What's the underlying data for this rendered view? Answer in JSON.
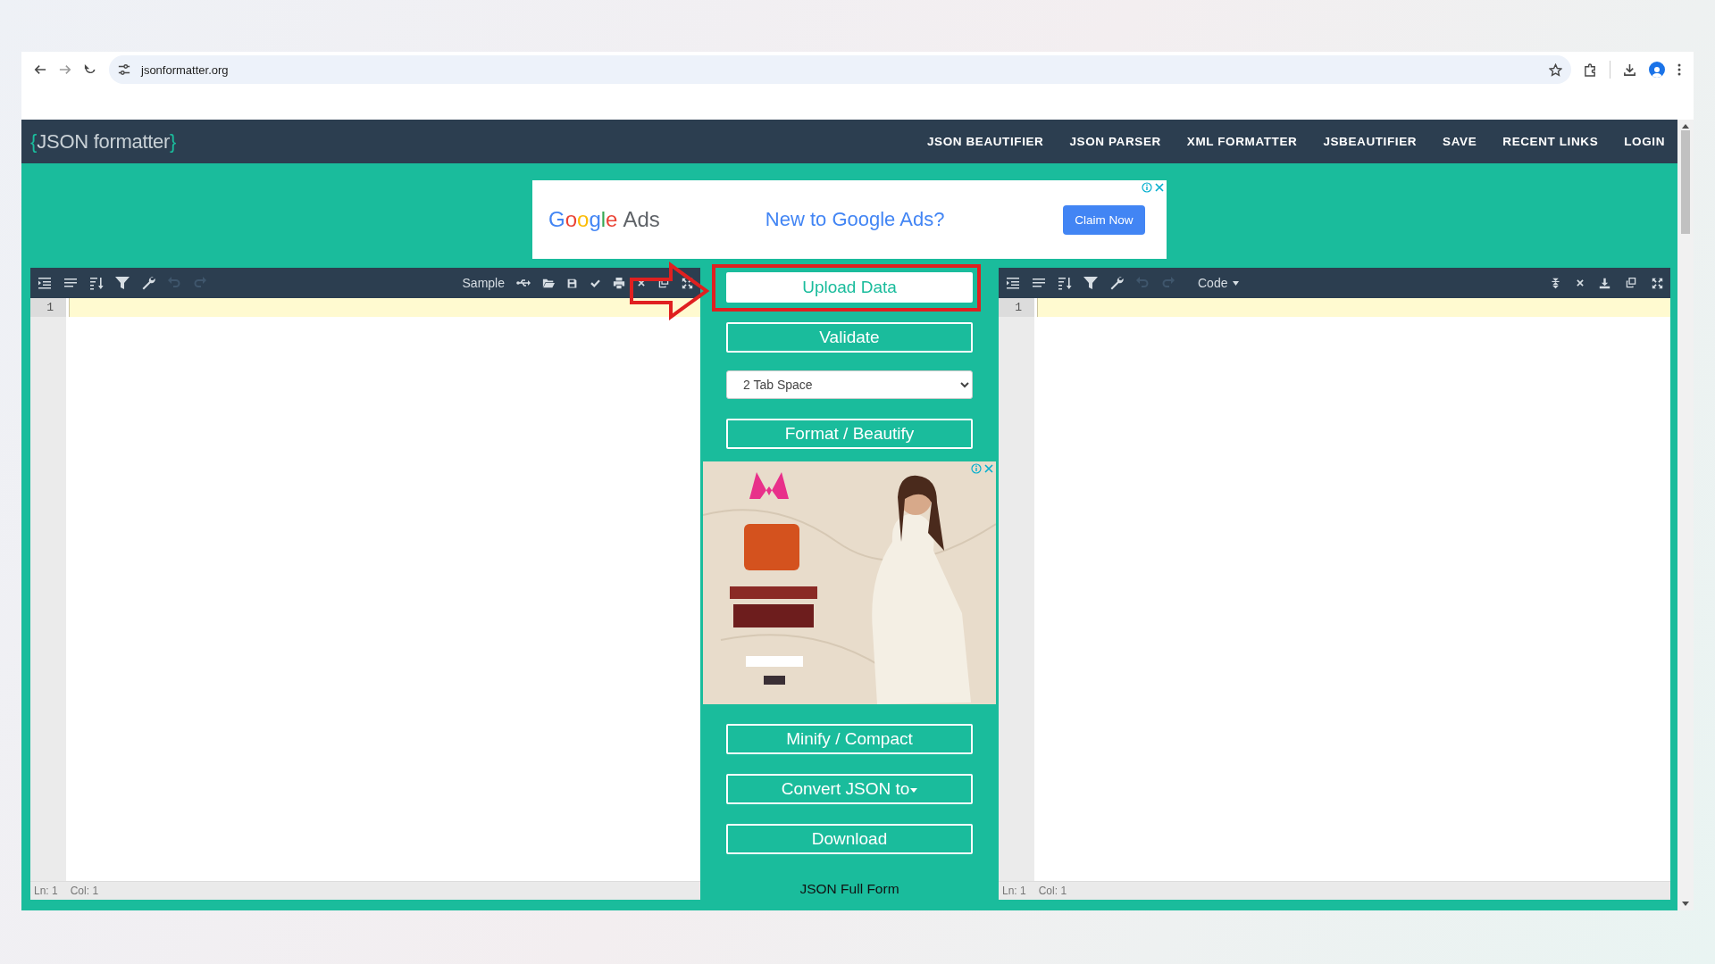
{
  "browser": {
    "url": "jsonformatter.org"
  },
  "site": {
    "logo": {
      "open": "{",
      "name": "JSON formatter",
      "close": "}"
    },
    "nav": [
      "JSON BEAUTIFIER",
      "JSON PARSER",
      "XML FORMATTER",
      "JSBEAUTIFIER",
      "SAVE",
      "RECENT LINKS",
      "LOGIN"
    ]
  },
  "ad_banner": {
    "brand": "Google",
    "brand_suffix": "Ads",
    "headline": "New to Google Ads?",
    "button": "Claim Now"
  },
  "left_editor": {
    "toolbar": {
      "sample": "Sample",
      "undo_disabled": true,
      "redo_disabled": true
    },
    "line_numbers": [
      "1"
    ],
    "status": {
      "line": "Ln: 1",
      "col": "Col: 1"
    }
  },
  "actions": [
    {
      "kind": "button",
      "label": "Upload Data",
      "filled": true,
      "highlighted": true
    },
    {
      "kind": "button",
      "label": "Validate",
      "filled": false,
      "highlighted": false
    },
    {
      "kind": "select",
      "value": "2 Tab Space"
    },
    {
      "kind": "button",
      "label": "Format / Beautify",
      "filled": false,
      "highlighted": false
    },
    {
      "kind": "picture"
    },
    {
      "kind": "button",
      "label": "Minify / Compact",
      "filled": false,
      "highlighted": false
    },
    {
      "kind": "dropdown",
      "label": "Convert JSON to",
      "filled": false,
      "highlighted": false
    },
    {
      "kind": "button",
      "label": "Download",
      "filled": false,
      "highlighted": false
    },
    {
      "kind": "link",
      "label": "JSON Full Form"
    }
  ],
  "right_editor": {
    "toolbar": {
      "mode": "Code",
      "undo_disabled": true,
      "redo_disabled": true
    },
    "line_numbers": [
      "1"
    ],
    "status": {
      "line": "Ln: 1",
      "col": "Col: 1"
    }
  }
}
